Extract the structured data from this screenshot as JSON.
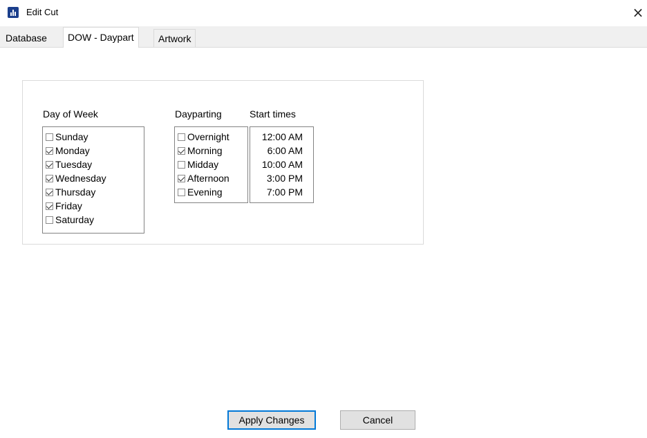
{
  "window": {
    "title": "Edit Cut",
    "close_glyph": "×",
    "icon": "app-chart-icon"
  },
  "tabs": [
    {
      "label": "Database",
      "active": false
    },
    {
      "label": "DOW - Daypart",
      "active": true
    },
    {
      "label": "Artwork",
      "active": false
    }
  ],
  "dow": {
    "heading": "Day of Week",
    "items": [
      {
        "label": "Sunday",
        "checked": false
      },
      {
        "label": "Monday",
        "checked": true
      },
      {
        "label": "Tuesday",
        "checked": true
      },
      {
        "label": "Wednesday",
        "checked": true
      },
      {
        "label": "Thursday",
        "checked": true
      },
      {
        "label": "Friday",
        "checked": true
      },
      {
        "label": "Saturday",
        "checked": false
      }
    ]
  },
  "dayparting": {
    "heading": "Dayparting",
    "items": [
      {
        "label": "Overnight",
        "checked": false
      },
      {
        "label": "Morning",
        "checked": true
      },
      {
        "label": "Midday",
        "checked": false
      },
      {
        "label": "Afternoon",
        "checked": true
      },
      {
        "label": "Evening",
        "checked": false
      }
    ]
  },
  "start_times": {
    "heading": "Start times",
    "items": [
      "12:00 AM",
      "6:00 AM",
      "10:00 AM",
      "3:00 PM",
      "7:00 PM"
    ]
  },
  "buttons": {
    "apply": "Apply Changes",
    "cancel": "Cancel"
  },
  "colors": {
    "focus_border": "#0078d7",
    "button_bg": "#e1e1e1",
    "app_icon": "#1b3f8c"
  }
}
